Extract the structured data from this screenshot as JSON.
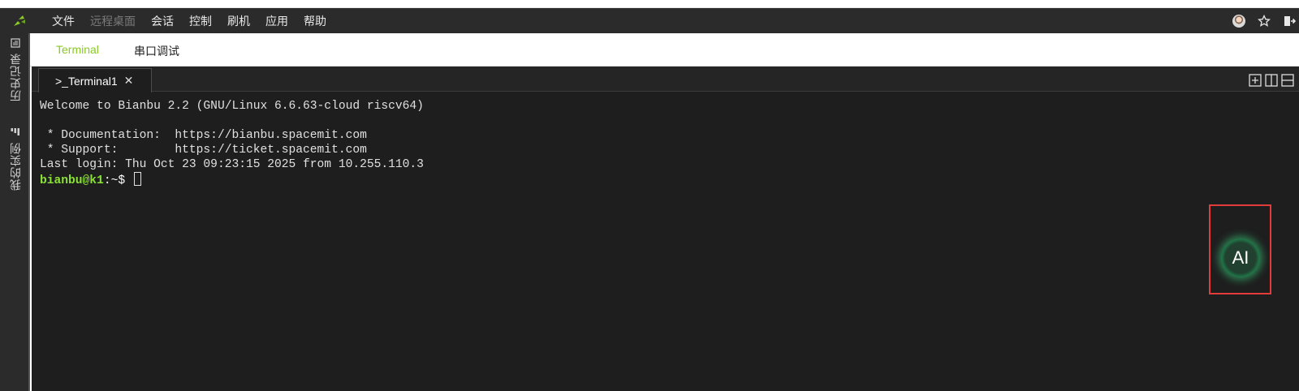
{
  "menubar": {
    "items": [
      {
        "label": "文件",
        "disabled": false
      },
      {
        "label": "远程桌面",
        "disabled": true
      },
      {
        "label": "会话",
        "disabled": false
      },
      {
        "label": "控制",
        "disabled": false
      },
      {
        "label": "刷机",
        "disabled": false
      },
      {
        "label": "应用",
        "disabled": false
      },
      {
        "label": "帮助",
        "disabled": false
      }
    ],
    "right_icons": [
      "avatar",
      "star-icon",
      "logout-icon"
    ]
  },
  "sidebar": {
    "history_label": "历史记录",
    "examples_label": "我的实例"
  },
  "subtabs": {
    "terminal": "Terminal",
    "serial": "串口调试"
  },
  "terminal_tab": {
    "title": ">_Terminal1",
    "close": "✕"
  },
  "terminal": {
    "lines": [
      "Welcome to Bianbu 2.2 (GNU/Linux 6.6.63-cloud riscv64)",
      "",
      " * Documentation:  https://bianbu.spacemit.com",
      " * Support:        https://ticket.spacemit.com",
      "Last login: Thu Oct 23 09:23:15 2025 from 10.255.110.3"
    ],
    "prompt_user": "bianbu@k1",
    "prompt_path": ":~$ "
  },
  "ai_button": {
    "label": "AI"
  },
  "colors": {
    "accent": "#8ac926",
    "prompt": "#8ae234",
    "highlight_box": "#e23b3b",
    "ai_glow": "#3ddc84"
  }
}
